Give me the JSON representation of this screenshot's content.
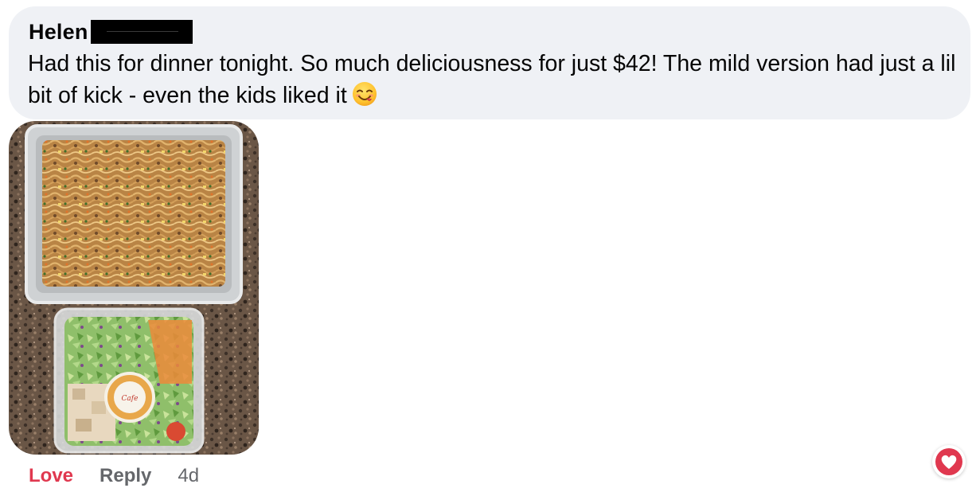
{
  "comment": {
    "author": "Helen",
    "text": "Had this for dinner tonight. So much deliciousness for just $42! The mild version had just a lil bit of kick - even the kids liked it",
    "emoji": "face-savoring-food-icon"
  },
  "photo": {
    "description_icons": [
      "noodle-tray-icon",
      "salad-container-icon"
    ]
  },
  "actions": {
    "love_label": "Love",
    "reply_label": "Reply",
    "timestamp": "4d"
  },
  "reaction": {
    "icon": "heart-icon",
    "color": "#e0384f"
  },
  "colors": {
    "bubble": "#eff1f5",
    "love": "#e0384f",
    "meta": "#65676b"
  }
}
